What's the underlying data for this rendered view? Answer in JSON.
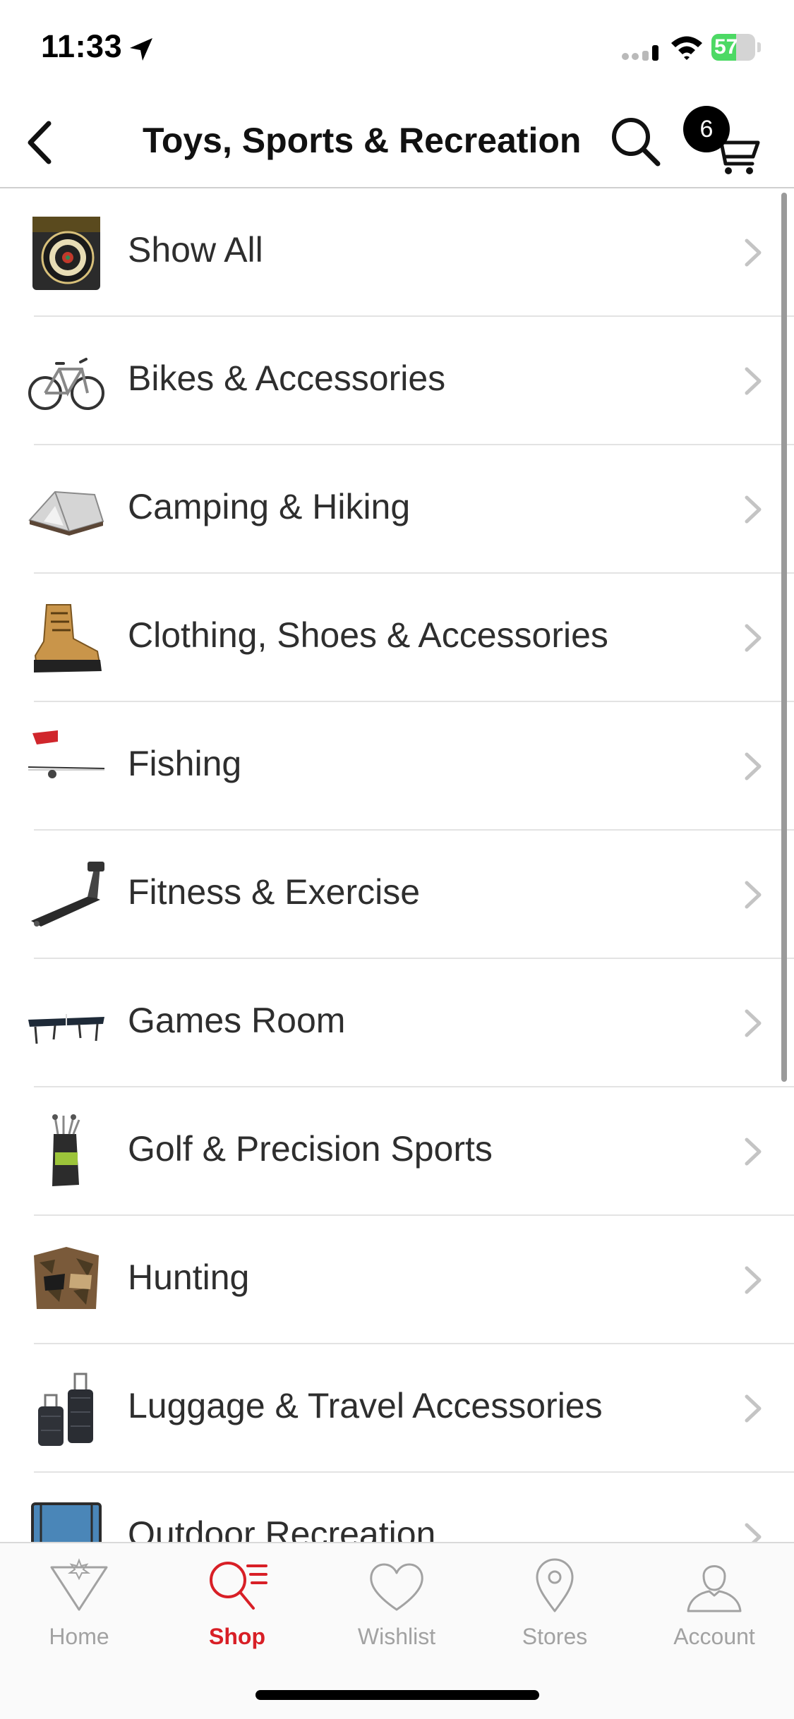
{
  "status_bar": {
    "time": "11:33",
    "battery_percent": "57",
    "battery_level": 0.57
  },
  "nav": {
    "title": "Toys, Sports & Recreation",
    "cart_count": "6"
  },
  "categories": [
    {
      "label": "Show All",
      "icon": "dartboard-thumbnail"
    },
    {
      "label": "Bikes & Accessories",
      "icon": "bicycle-thumbnail"
    },
    {
      "label": "Camping & Hiking",
      "icon": "tent-thumbnail"
    },
    {
      "label": "Clothing, Shoes & Accessories",
      "icon": "boot-thumbnail"
    },
    {
      "label": "Fishing",
      "icon": "fishing-rod-thumbnail"
    },
    {
      "label": "Fitness & Exercise",
      "icon": "treadmill-thumbnail"
    },
    {
      "label": "Games Room",
      "icon": "ping-pong-table-thumbnail"
    },
    {
      "label": "Golf & Precision Sports",
      "icon": "golf-bag-thumbnail"
    },
    {
      "label": "Hunting",
      "icon": "hunting-blind-thumbnail"
    },
    {
      "label": "Luggage & Travel Accessories",
      "icon": "luggage-thumbnail"
    },
    {
      "label": "Outdoor Recreation",
      "icon": "trampoline-thumbnail"
    }
  ],
  "tabs": [
    {
      "label": "Home",
      "icon": "home-icon",
      "active": false
    },
    {
      "label": "Shop",
      "icon": "shop-search-icon",
      "active": true
    },
    {
      "label": "Wishlist",
      "icon": "heart-icon",
      "active": false
    },
    {
      "label": "Stores",
      "icon": "location-pin-icon",
      "active": false
    },
    {
      "label": "Account",
      "icon": "person-icon",
      "active": false
    }
  ],
  "colors": {
    "accent": "#d81f26",
    "inactive_tab": "#a2a2a2",
    "battery_fill": "#4cd964"
  }
}
